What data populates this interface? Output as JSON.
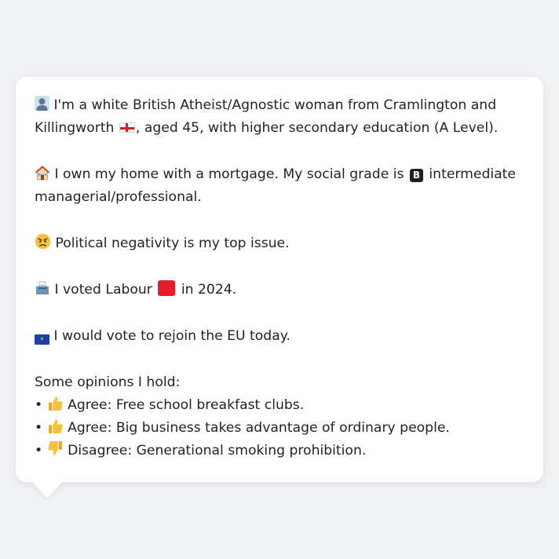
{
  "bio": {
    "line1_a": "I'm a white British Atheist/Agnostic woman from Cramlington and Killingworth",
    "line1_b": ", aged 45, with higher secondary education (A Level)."
  },
  "home": {
    "text_a": "I own my home with a mortgage. My social grade is",
    "grade_letter": "B",
    "text_b": "intermediate managerial/professional."
  },
  "issue": {
    "text": "Political negativity is my top issue."
  },
  "vote": {
    "text_a": "I voted Labour",
    "text_b": "in 2024."
  },
  "eu": {
    "text": "I would vote to rejoin the EU today."
  },
  "opinions": {
    "heading": "Some opinions I hold:",
    "items": [
      {
        "stance": "Agree",
        "statement": "Free school breakfast clubs.",
        "icon": "thumbs-up-icon"
      },
      {
        "stance": "Agree",
        "statement": "Big business takes advantage of ordinary people.",
        "icon": "thumbs-up-icon"
      },
      {
        "stance": "Disagree",
        "statement": "Generational smoking prohibition.",
        "icon": "thumbs-down-icon"
      }
    ]
  },
  "icons": {
    "person": "person-silhouette-icon",
    "flag": "england-flag-icon",
    "home": "house-icon",
    "grade": "letter-b-icon",
    "issue": "angry-face-icon",
    "vote": "ballot-box-icon",
    "party": "red-square-icon",
    "eu": "eu-flag-icon"
  },
  "colors": {
    "background": "#f1f2f4",
    "bubble": "#ffffff",
    "text": "#1e2227",
    "labour_red": "#e21c28",
    "eu_blue": "#1f3fa0"
  }
}
